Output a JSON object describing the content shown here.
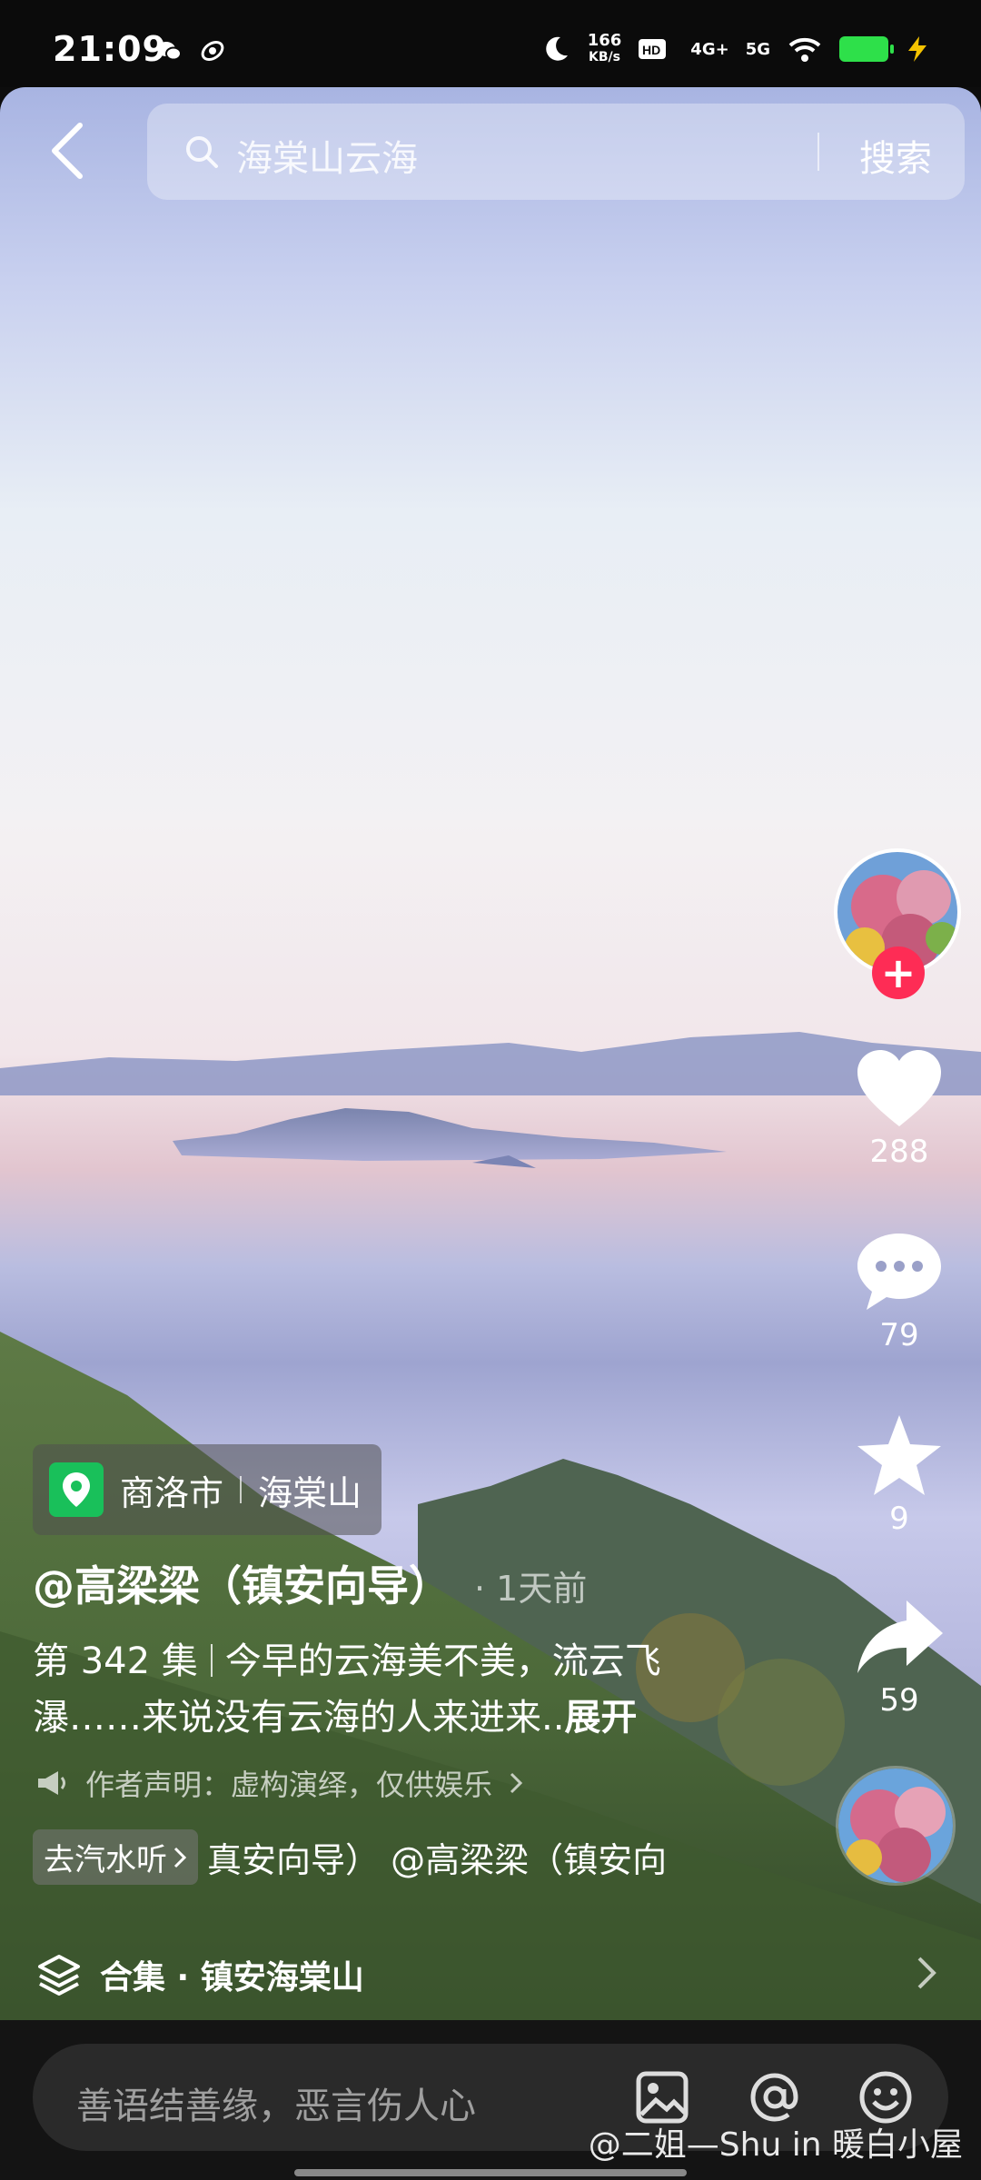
{
  "status_bar": {
    "time": "21:09",
    "speed_value": "166",
    "speed_unit": "KB/s",
    "network_1": "4G+",
    "network_2": "5G",
    "icons": [
      "wechat-icon",
      "sync-icon",
      "moon-icon",
      "hd-icon",
      "wifi-icon",
      "battery-icon",
      "charging-icon"
    ]
  },
  "search": {
    "query": "海棠山云海",
    "button_label": "搜索"
  },
  "actions": {
    "likes": "288",
    "comments": "79",
    "favorites": "9",
    "shares": "59"
  },
  "video_info": {
    "location_city": "商洛市",
    "location_place": "海棠山",
    "author": "@高梁梁（镇安向导）",
    "time_ago": "· 1天前",
    "desc_episode": "第 342 集",
    "desc_line1": "今早的云海美不美，流云飞",
    "desc_line2": "瀑……来说没有云海的人来进来..",
    "expand_label": "展开",
    "notice": "作者声明：虚构演绎，仅供娱乐",
    "music_tag": "去汽水听",
    "music_scroll": "真安向导）     @高梁梁（镇安向"
  },
  "collection": {
    "label": "合集 · 镇安海棠山"
  },
  "comment_bar": {
    "placeholder": "善语结善缘，恶言伤人心"
  },
  "watermark": "@二姐—Shu in 暖白小屋",
  "colors": {
    "follow_red": "#fe2c55",
    "location_green": "#19c05a",
    "battery_green": "#2ee04a"
  }
}
